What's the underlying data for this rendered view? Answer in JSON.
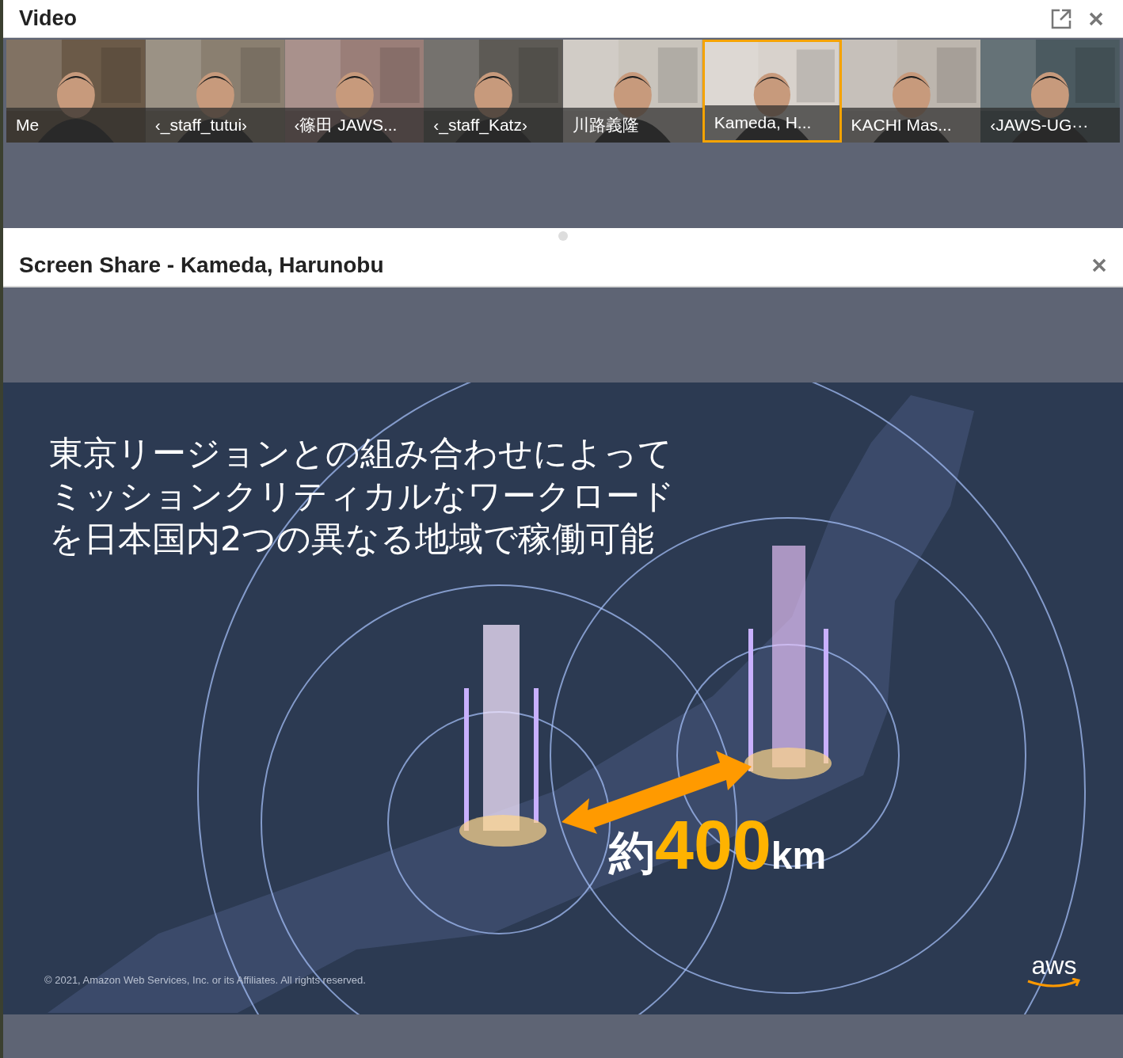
{
  "video_panel": {
    "title": "Video",
    "participants": [
      {
        "name": "Me",
        "selected": false
      },
      {
        "name": "‹_staff_tutui›",
        "selected": false
      },
      {
        "name": "‹篠田 JAWS...",
        "selected": false
      },
      {
        "name": "‹_staff_Katz›",
        "selected": false
      },
      {
        "name": "川路義隆",
        "selected": false
      },
      {
        "name": "Kameda, H...",
        "selected": true
      },
      {
        "name": "KACHI Mas...",
        "selected": false
      },
      {
        "name": "‹JAWS-UG···",
        "selected": false
      }
    ]
  },
  "screen_share": {
    "title": "Screen Share - Kameda, Harunobu",
    "slide": {
      "heading_lines": [
        "東京リージョンとの組み合わせによって",
        "ミッションクリティカルなワークロード",
        "を日本国内2つの異なる地域で稼働可能"
      ],
      "distance": {
        "prefix": "約",
        "value": "400",
        "unit": "km"
      },
      "copyright": "© 2021, Amazon Web Services, Inc. or its Affiliates. All rights reserved.",
      "logo": "aws"
    }
  }
}
